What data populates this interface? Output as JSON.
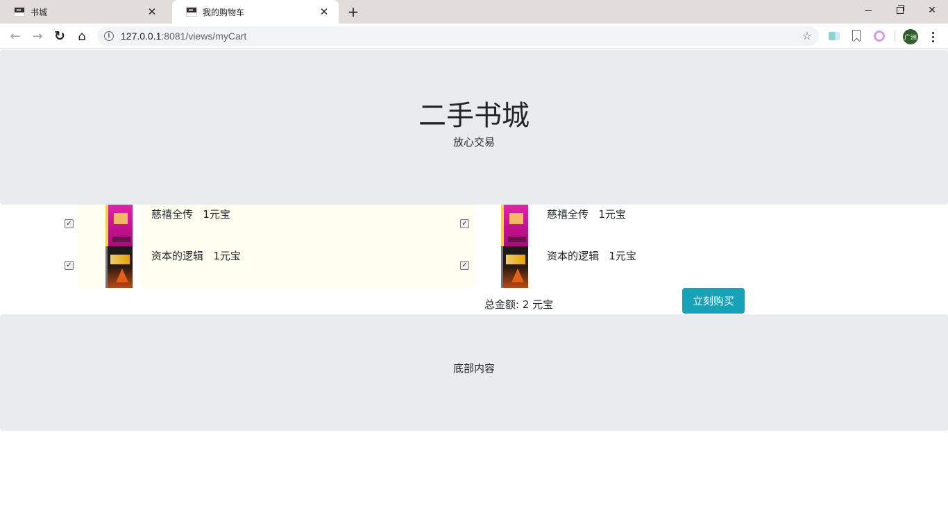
{
  "browser": {
    "tabs": [
      {
        "title": "书城",
        "active": false
      },
      {
        "title": "我的购物车",
        "active": true
      }
    ],
    "new_tab_label": "+",
    "url_host": "127.0.0.1",
    "url_path": ":8081/views/myCart",
    "profile_label": "广洲"
  },
  "header": {
    "title": "二手书城",
    "slogan": "放心交易"
  },
  "cart": {
    "left_items": [
      {
        "name": "慈禧全传",
        "price": "1元宝",
        "checked": true,
        "cover_icon": "book-cover-cixi"
      },
      {
        "name": "资本的逻辑",
        "price": "1元宝",
        "checked": true,
        "cover_icon": "book-cover-ziben"
      }
    ],
    "right_items": [
      {
        "name": "慈禧全传",
        "price": "1元宝",
        "checked": true,
        "cover_icon": "book-cover-cixi"
      },
      {
        "name": "资本的逻辑",
        "price": "1元宝",
        "checked": true,
        "cover_icon": "book-cover-ziben"
      }
    ],
    "total_label": "总金额: 2 元宝",
    "buy_label": "立刻购买",
    "buy_color": "#17a2b8"
  },
  "footer": {
    "text": "底部内容"
  }
}
